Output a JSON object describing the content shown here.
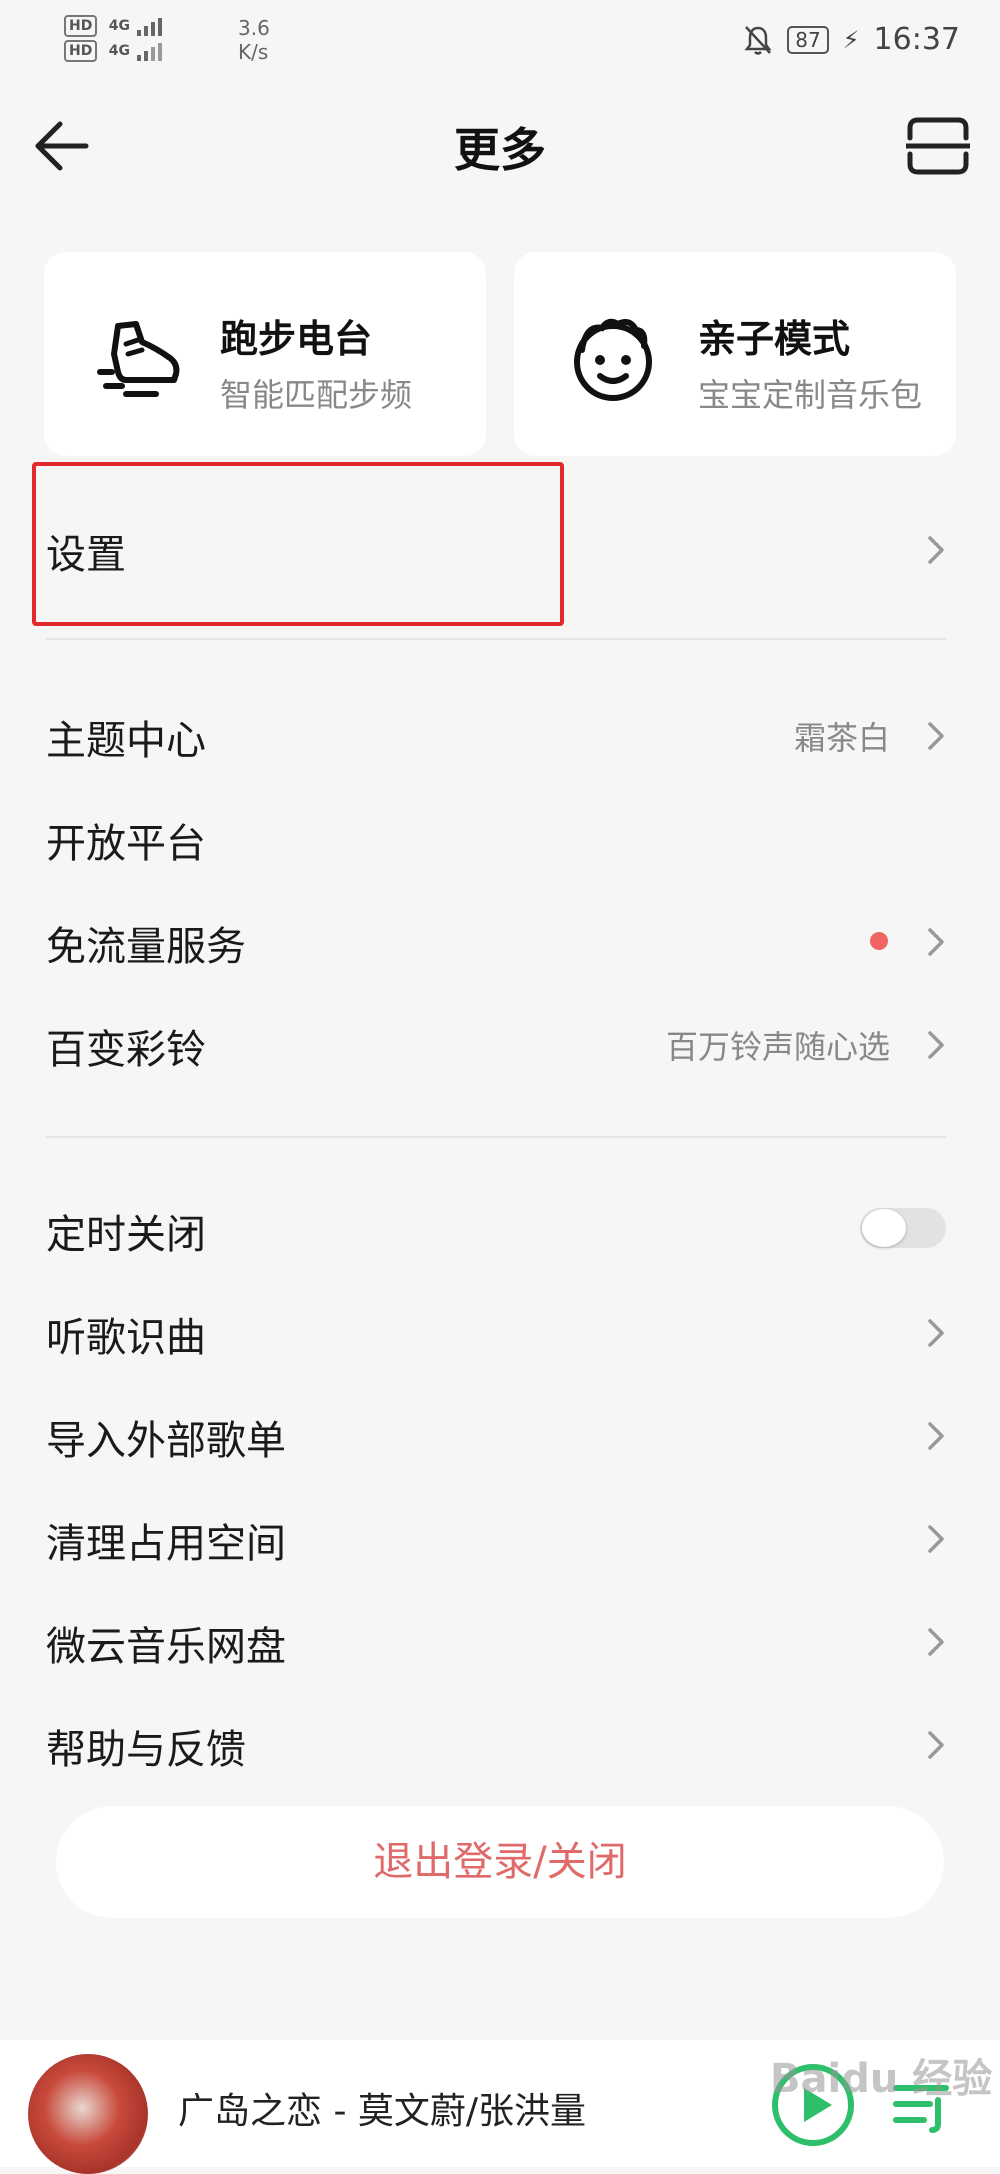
{
  "status_bar": {
    "hd1": "HD",
    "hd2": "HD",
    "net1": "4G",
    "net2": "4G",
    "speed_value": "3.6",
    "speed_unit": "K/s",
    "battery": "87",
    "time": "16:37"
  },
  "header": {
    "title": "更多"
  },
  "cards": [
    {
      "title": "跑步电台",
      "subtitle": "智能匹配步频",
      "icon": "running-shoe-icon"
    },
    {
      "title": "亲子模式",
      "subtitle": "宝宝定制音乐包",
      "icon": "baby-face-icon"
    }
  ],
  "settings_row": {
    "label": "设置"
  },
  "group1": [
    {
      "label": "主题中心",
      "value": "霜茶白"
    },
    {
      "label": "开放平台",
      "value": ""
    },
    {
      "label": "免流量服务",
      "value": ""
    },
    {
      "label": "百变彩铃",
      "value": "百万铃声随心选"
    }
  ],
  "group2": [
    {
      "label": "定时关闭",
      "toggle_on": false
    },
    {
      "label": "听歌识曲"
    },
    {
      "label": "导入外部歌单"
    },
    {
      "label": "清理占用空间"
    },
    {
      "label": "微云音乐网盘"
    },
    {
      "label": "帮助与反馈"
    }
  ],
  "logout_label": "退出登录/关闭",
  "player": {
    "song": "广岛之恋 - 莫文蔚/张洪量"
  },
  "colors": {
    "accent_red": "#e12a2a",
    "logout_text": "#e06a6a",
    "play_green": "#2ebf6a",
    "badge_dot": "#f06464"
  },
  "watermark": "Baidu 经验"
}
